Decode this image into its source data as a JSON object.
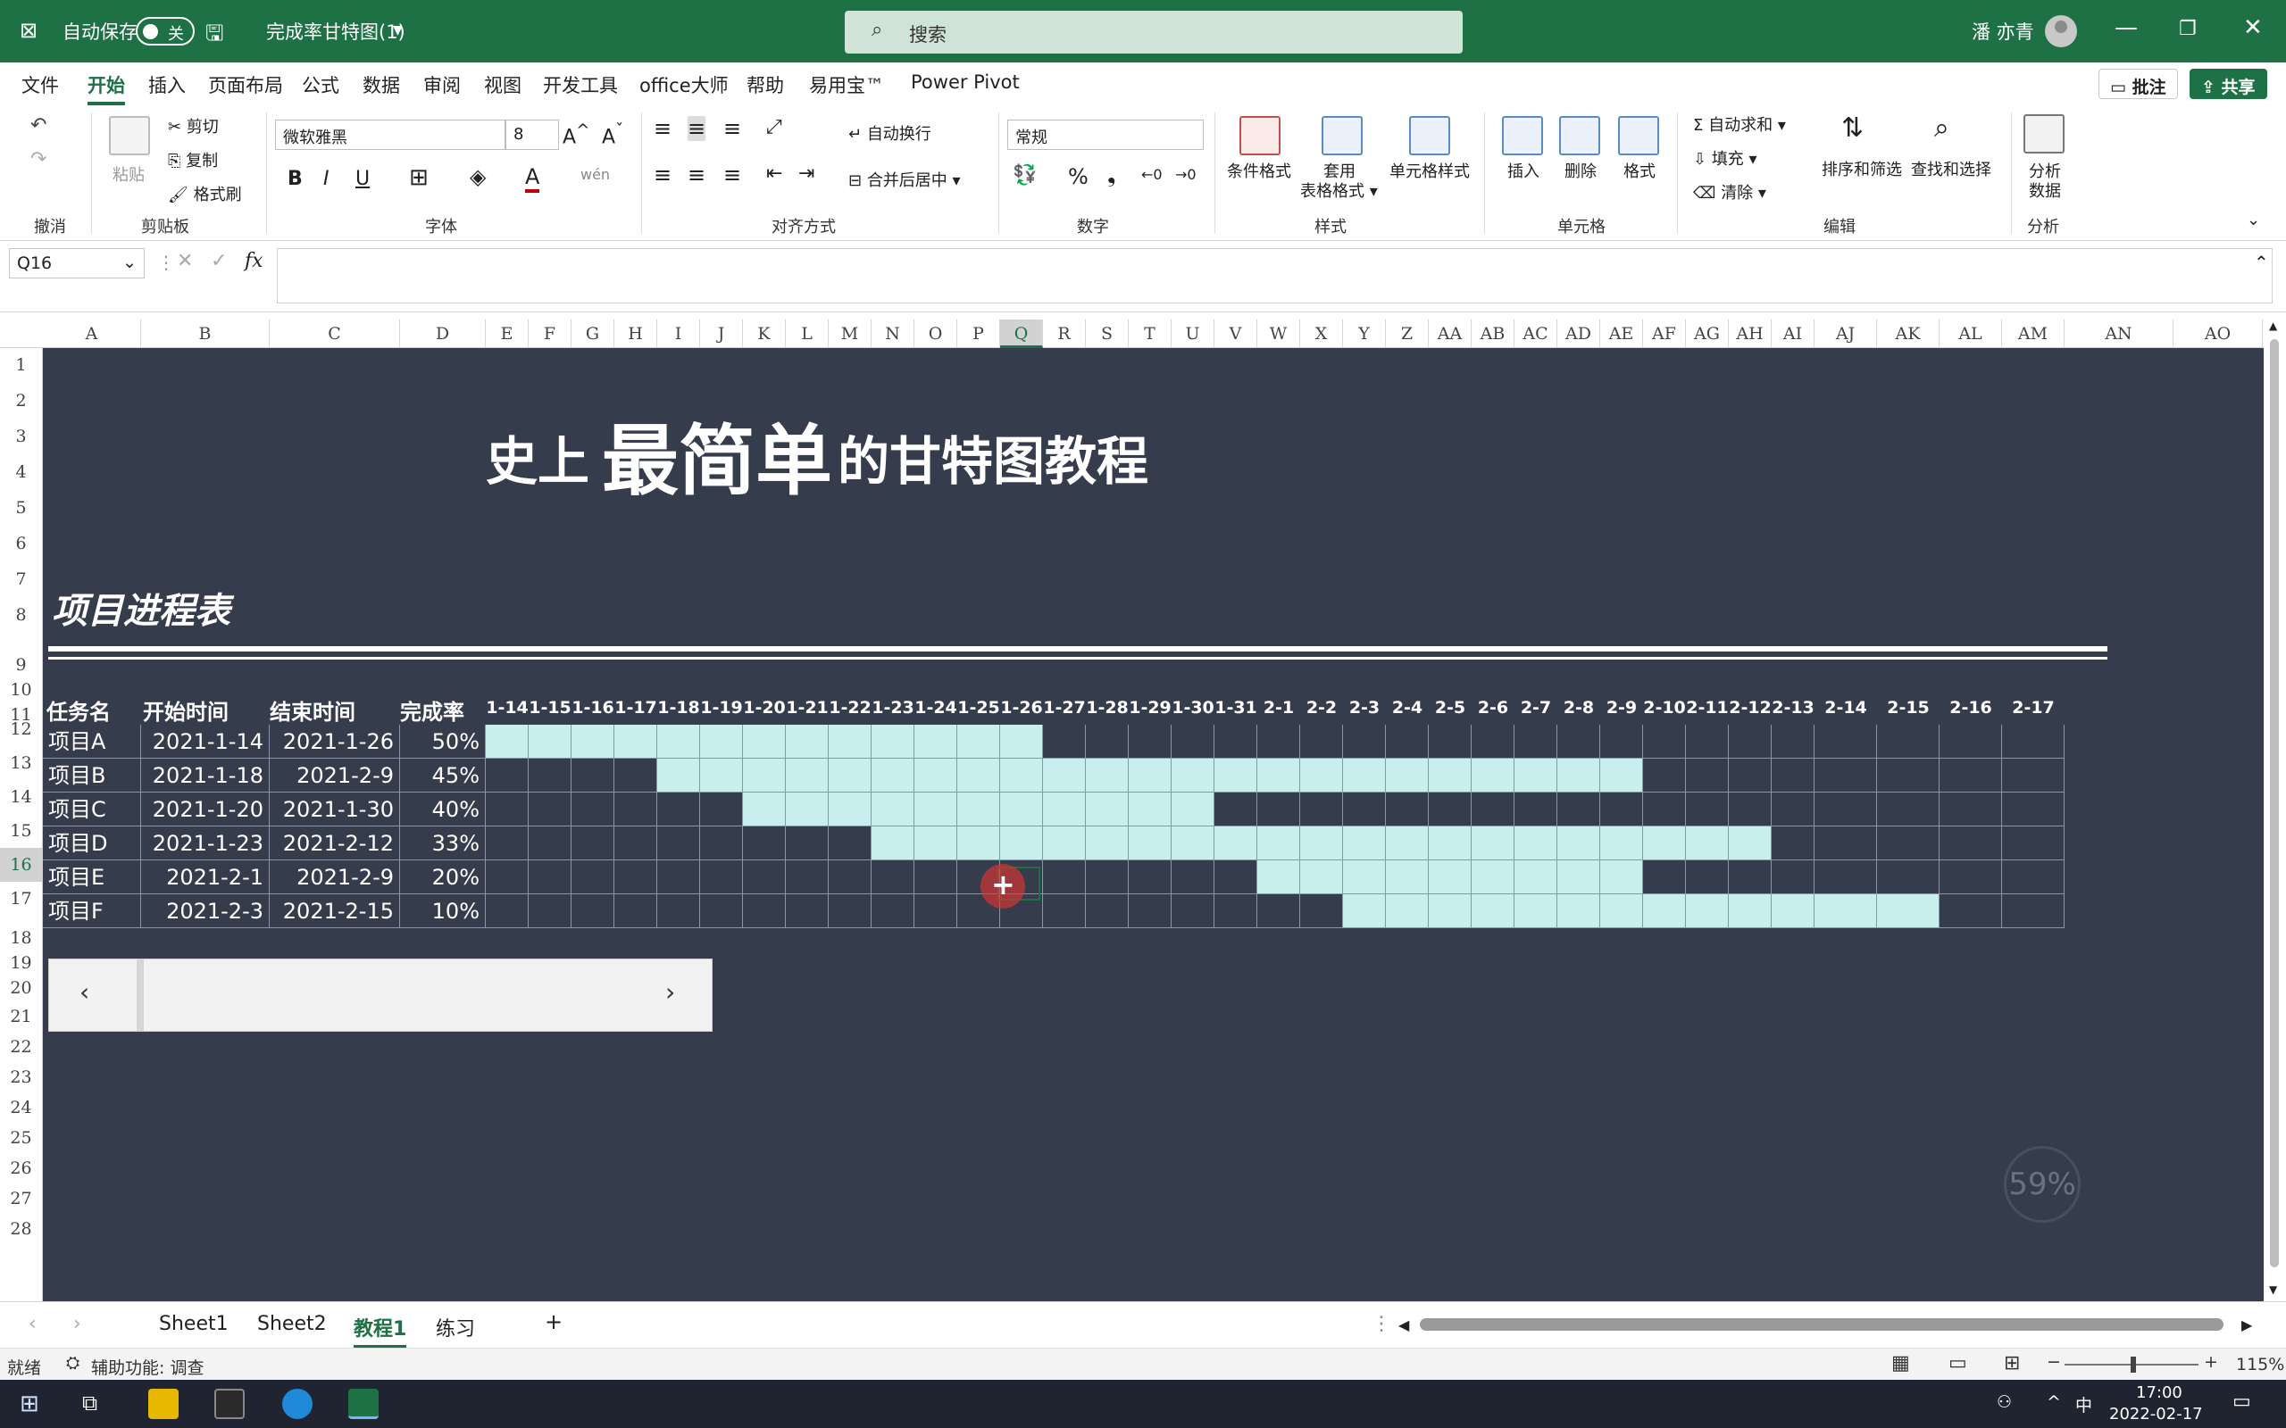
{
  "titlebar": {
    "autosave": "自动保存",
    "toggle": "关",
    "filename": "完成率甘特图(1)",
    "search_placeholder": "搜索",
    "user": "潘 亦青"
  },
  "menu": {
    "items": [
      "文件",
      "开始",
      "插入",
      "页面布局",
      "公式",
      "数据",
      "审阅",
      "视图",
      "开发工具",
      "office大师",
      "帮助",
      "易用宝™",
      "Power Pivot"
    ],
    "active": "开始",
    "comment": "批注",
    "share": "共享"
  },
  "ribbon": {
    "undo": "撤消",
    "paste": "粘贴",
    "cut": "剪切",
    "copy": "复制",
    "format_painter": "格式刷",
    "clipboard": "剪贴板",
    "font_name": "微软雅黑",
    "font_size": "8",
    "font": "字体",
    "wrap": "自动换行",
    "merge": "合并后居中",
    "align": "对齐方式",
    "number_format": "常规",
    "number": "数字",
    "cond_format": "条件格式",
    "table_format": "套用\n表格格式",
    "cell_style": "单元格样式",
    "styles": "样式",
    "insert": "插入",
    "delete": "删除",
    "format": "格式",
    "cells": "单元格",
    "autosum": "自动求和",
    "fill": "填充",
    "clear": "清除",
    "sort_filter": "排序和筛选",
    "find_select": "查找和选择",
    "edit": "编辑",
    "analyze": "分析\n数据",
    "analysis": "分析"
  },
  "formula": {
    "namebox": "Q16",
    "fx": "fx",
    "value": ""
  },
  "columns": [
    "A",
    "B",
    "C",
    "D",
    "E",
    "F",
    "G",
    "H",
    "I",
    "J",
    "K",
    "L",
    "M",
    "N",
    "O",
    "P",
    "Q",
    "R",
    "S",
    "T",
    "U",
    "V",
    "W",
    "X",
    "Y",
    "Z",
    "AA",
    "AB",
    "AC",
    "AD",
    "AE",
    "AF",
    "AG",
    "AH",
    "AI",
    "AJ",
    "AK",
    "AL",
    "AM",
    "AN",
    "AO"
  ],
  "selected_column": "Q",
  "rows": [
    "1",
    "2",
    "3",
    "4",
    "5",
    "6",
    "7",
    "8",
    "9",
    "10",
    "11",
    "12",
    "13",
    "14",
    "15",
    "16",
    "17",
    "18",
    "19",
    "20",
    "21",
    "22",
    "23",
    "24",
    "25",
    "26",
    "27",
    "28"
  ],
  "selected_row": "16",
  "sheet": {
    "title_parts": [
      "史上",
      "最简单",
      "的甘特图教程"
    ],
    "section_title": "项目进程表",
    "headers": [
      "任务名",
      "开始时间",
      "结束时间",
      "完成率"
    ],
    "dates": [
      "1-14",
      "1-15",
      "1-16",
      "1-17",
      "1-18",
      "1-19",
      "1-20",
      "1-21",
      "1-22",
      "1-23",
      "1-24",
      "1-25",
      "1-26",
      "1-27",
      "1-28",
      "1-29",
      "1-30",
      "1-31",
      "2-1",
      "2-2",
      "2-3",
      "2-4",
      "2-5",
      "2-6",
      "2-7",
      "2-8",
      "2-9",
      "2-10",
      "2-11",
      "2-12",
      "2-13",
      "2-14",
      "2-15",
      "2-16",
      "2-17"
    ],
    "tasks": [
      {
        "name": "项目A",
        "start": "2021-1-14",
        "end": "2021-1-26",
        "rate": "50%",
        "from": 0,
        "to": 12
      },
      {
        "name": "项目B",
        "start": "2021-1-18",
        "end": "2021-2-9",
        "rate": "45%",
        "from": 4,
        "to": 26
      },
      {
        "name": "项目C",
        "start": "2021-1-20",
        "end": "2021-1-30",
        "rate": "40%",
        "from": 6,
        "to": 16
      },
      {
        "name": "项目D",
        "start": "2021-1-23",
        "end": "2021-2-12",
        "rate": "33%",
        "from": 9,
        "to": 29
      },
      {
        "name": "项目E",
        "start": "2021-2-1",
        "end": "2021-2-9",
        "rate": "20%",
        "from": 18,
        "to": 26
      },
      {
        "name": "项目F",
        "start": "2021-2-3",
        "end": "2021-2-15",
        "rate": "10%",
        "from": 20,
        "to": 32
      }
    ],
    "progress_widget": "59%"
  },
  "tabs": [
    "Sheet1",
    "Sheet2",
    "教程1",
    "练习"
  ],
  "active_tab": "教程1",
  "status": {
    "ready": "就绪",
    "accessibility": "辅助功能: 调查",
    "zoom": "115%"
  },
  "taskbar": {
    "time": "17:00",
    "date": "2022-02-17",
    "ime": "中"
  },
  "colors": {
    "excel_green": "#1e7145",
    "sheet_bg": "#353c4c",
    "bar": "#c9eeee"
  }
}
